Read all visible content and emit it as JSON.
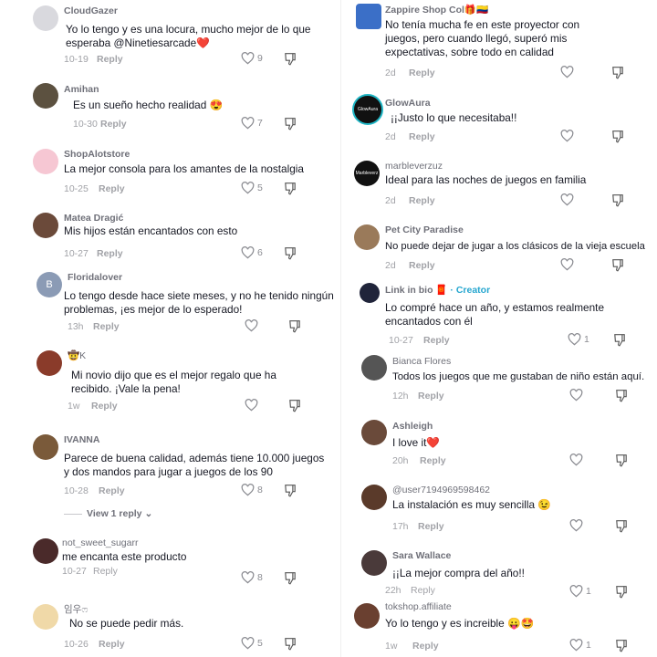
{
  "left": [
    {
      "user": "CloudGazer",
      "text": "Yo lo tengo y es una locura, mucho mejor de lo que esperaba @Ninetiesarcade❤️",
      "time": "10-19",
      "reply": "Reply",
      "likes": "9",
      "avatar_color": "#d9d9de"
    },
    {
      "user": "Amihan",
      "text": "Es un sueño hecho realidad 😍",
      "time": "10-30",
      "reply": "Reply",
      "likes": "7",
      "avatar_color": "#5c5140"
    },
    {
      "user": "ShopAlotstore",
      "text": "La mejor consola para los amantes de la nostalgia",
      "time": "10-25",
      "reply": "Reply",
      "likes": "5",
      "avatar_color": "#f6c7d3"
    },
    {
      "user": "Matea Dragić",
      "text": "Mis hijos están encantados con esto",
      "time": "10-27",
      "reply": "Reply",
      "likes": "6",
      "avatar_color": "#6b4a3a"
    },
    {
      "user": "Floridalover",
      "text": "Lo tengo desde hace siete meses, y no he tenido ningún problemas, ¡es mejor de lo esperado!",
      "time": "13h",
      "reply": "Reply",
      "likes": "",
      "avatar_letter": "B",
      "avatar_color": "#8b9bb5"
    },
    {
      "user": "🤠K",
      "text": "Mi novio dijo que es el mejor regalo que ha recibido. ¡Vale la pena!",
      "time": "1w",
      "reply": "Reply",
      "likes": "",
      "avatar_color": "#8a3b2a"
    },
    {
      "user": "IVANNA",
      "text": "Parece de buena calidad, además tiene 10.000 juegos y dos mandos para jugar a juegos de los 90",
      "time": "10-28",
      "reply": "Reply",
      "likes": "8",
      "view_replies": "View 1 reply",
      "avatar_color": "#7a5a3a"
    },
    {
      "user": "not_sweet_sugarr",
      "text": "me encanta este producto",
      "time": "10-27",
      "reply": "Reply",
      "likes": "8",
      "avatar_color": "#4a2a2a"
    },
    {
      "user": "임우ෆ",
      "text": "No se puede pedir más.",
      "time": "10-26",
      "reply": "Reply",
      "likes": "5",
      "avatar_color": "#f0d9a8"
    }
  ],
  "right": [
    {
      "user": "Zappire Shop Col🎁🇨🇴",
      "text": "No tenía mucha fe en este proyector con juegos, pero cuando llegó, superó mis expectativas, sobre todo en calidad",
      "time": "2d",
      "reply": "Reply",
      "likes": "",
      "avatar_color": "#3b6fc7"
    },
    {
      "user": "GlowAura",
      "text": "¡¡Justo lo que necesitaba!!",
      "time": "2d",
      "reply": "Reply",
      "likes": "",
      "avatar_text": "GlowAura",
      "avatar_color": "#111111"
    },
    {
      "user": "marbleverzuz",
      "text": "Ideal para las noches de juegos en familia",
      "time": "2d",
      "reply": "Reply",
      "likes": "",
      "avatar_text": "Marbleverz",
      "avatar_color": "#111111"
    },
    {
      "user": "Pet City Paradise",
      "text": "No puede dejar de jugar a los clásicos de la vieja escuela",
      "time": "2d",
      "reply": "Reply",
      "likes": "",
      "avatar_color": "#9a7a5a"
    },
    {
      "user": "Link in bio 🧧",
      "creator": "· Creator",
      "text": "Lo compré hace un año, y estamos realmente encantados con él",
      "time": "10-27",
      "reply": "Reply",
      "likes": "1",
      "avatar_color": "#20243a"
    },
    {
      "user": "Bianca Flores",
      "text": "Todos los juegos que me gustaban de niño están aquí.",
      "time": "12h",
      "reply": "Reply",
      "likes": "",
      "avatar_color": "#555555"
    },
    {
      "user": "Ashleigh",
      "text": "I love it❤️",
      "time": "20h",
      "reply": "Reply",
      "likes": "",
      "avatar_color": "#6a4a3a"
    },
    {
      "user": "@user7194969598462",
      "text": "La instalación es muy sencilla 😉",
      "time": "17h",
      "reply": "Reply",
      "likes": "",
      "avatar_color": "#5a3a2a"
    },
    {
      "user": "Sara Wallace",
      "text": "¡¡La mejor compra del año!!",
      "time": "22h",
      "reply": "Reply",
      "likes": "1",
      "avatar_color": "#4a3a3a"
    },
    {
      "user": "tokshop.affiliate",
      "text": "Yo lo tengo y es increible 😛🤩",
      "time": "1w",
      "reply": "Reply",
      "likes": "1",
      "avatar_color": "#6a4030"
    }
  ]
}
